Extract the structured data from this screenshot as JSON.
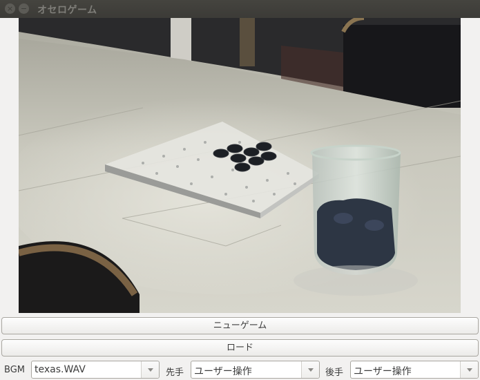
{
  "window": {
    "title": "オセロゲーム",
    "close_icon": "×",
    "minimize_icon": "−"
  },
  "image": {
    "description": "Photo of a clear acrylic Othello board with black pieces on a white table, next to a glass jar filled with black pieces"
  },
  "buttons": {
    "new_game": "ニューゲーム",
    "load": "ロード"
  },
  "settings": {
    "bgm_label": "BGM",
    "bgm_value": "texas.WAV",
    "first_label": "先手",
    "first_value": "ユーザー操作",
    "second_label": "後手",
    "second_value": "ユーザー操作"
  }
}
